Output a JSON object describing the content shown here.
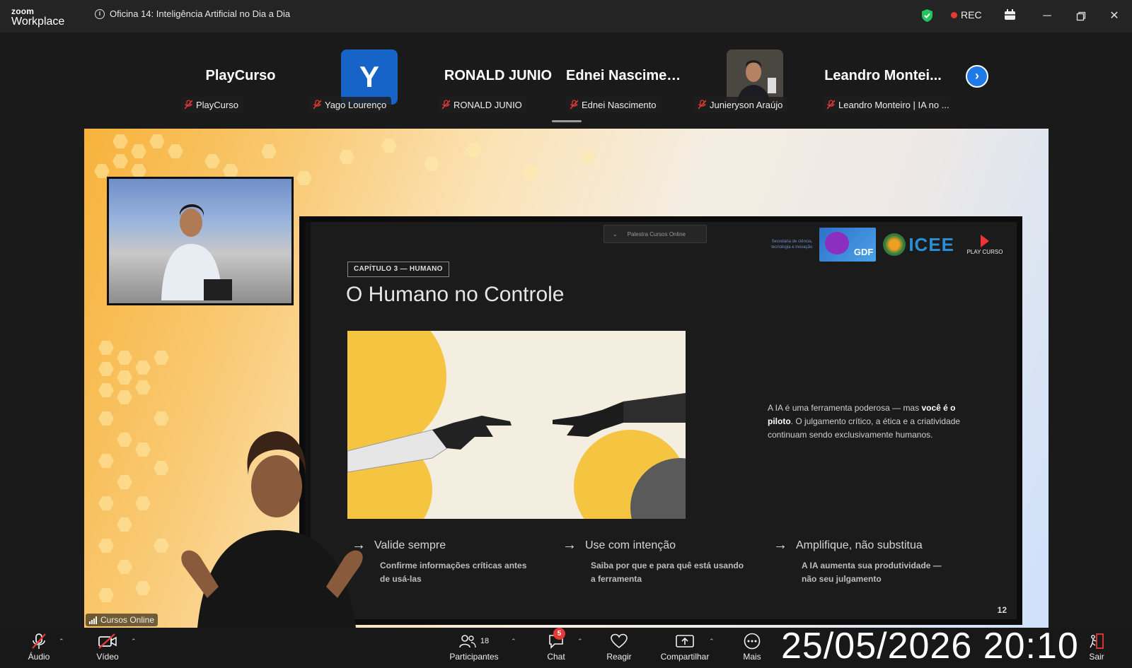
{
  "app": {
    "brand_small": "zoom",
    "brand_name": "Workplace",
    "meeting_title": "Oficina 14: Inteligência Artificial no Dia a Dia",
    "rec_label": "REC"
  },
  "participants": [
    {
      "display": "PlayCurso",
      "label": "PlayCurso",
      "type": "name"
    },
    {
      "display": "Y",
      "label": "Yago Lourenço",
      "type": "avatar"
    },
    {
      "display": "RONALD JUNIO",
      "label": "RONALD JUNIO",
      "type": "name"
    },
    {
      "display": "Ednei Nascimento",
      "label": "Ednei Nascimento",
      "type": "name"
    },
    {
      "display": "",
      "label": "Junieryson Araújo",
      "type": "photo"
    },
    {
      "display": "Leandro  Montei...",
      "label": "Leandro Monteiro | IA no ...",
      "type": "name"
    }
  ],
  "slide": {
    "menu_label": "Palestra Cursos Online",
    "logo_secretaria": "Secretaria de ciência, tecnologia e inovação",
    "logo_gdf": "GDF",
    "logo_icee": "ICEE",
    "logo_play": "PLAY CURSO",
    "chapter": "CAPÍTULO 3 — HUMANO",
    "title": "O Humano no Controle",
    "paragraph_pre": "A IA é uma ferramenta poderosa — mas ",
    "paragraph_bold": "você é o piloto",
    "paragraph_post": ". O julgamento crítico, a ética e a criatividade continuam sendo exclusivamente humanos.",
    "features": [
      {
        "title": "Valide sempre",
        "body": "Confirme informações críticas antes de usá-las"
      },
      {
        "title": "Use com intenção",
        "body": "Saiba por que e para quê está usando a ferramenta"
      },
      {
        "title": "Amplifique, não substitua",
        "body": "A IA aumenta sua produtividade — não seu julgamento"
      }
    ],
    "page_number": "12"
  },
  "share_tag": "Cursos Online",
  "toolbar": {
    "audio": "Áudio",
    "video": "Vídeo",
    "participants": "Participantes",
    "participants_count": "18",
    "chat": "Chat",
    "chat_badge": "5",
    "react": "Reagir",
    "share": "Compartilhar",
    "more": "Mais",
    "leave": "Sair"
  },
  "overlay_timestamp": "25/05/2026 20:10",
  "colors": {
    "accent": "#1e7ae6",
    "rec": "#e53935",
    "shield": "#22c55e",
    "slide_bg": "#1b1b1b",
    "highlight": "#f5c542"
  }
}
